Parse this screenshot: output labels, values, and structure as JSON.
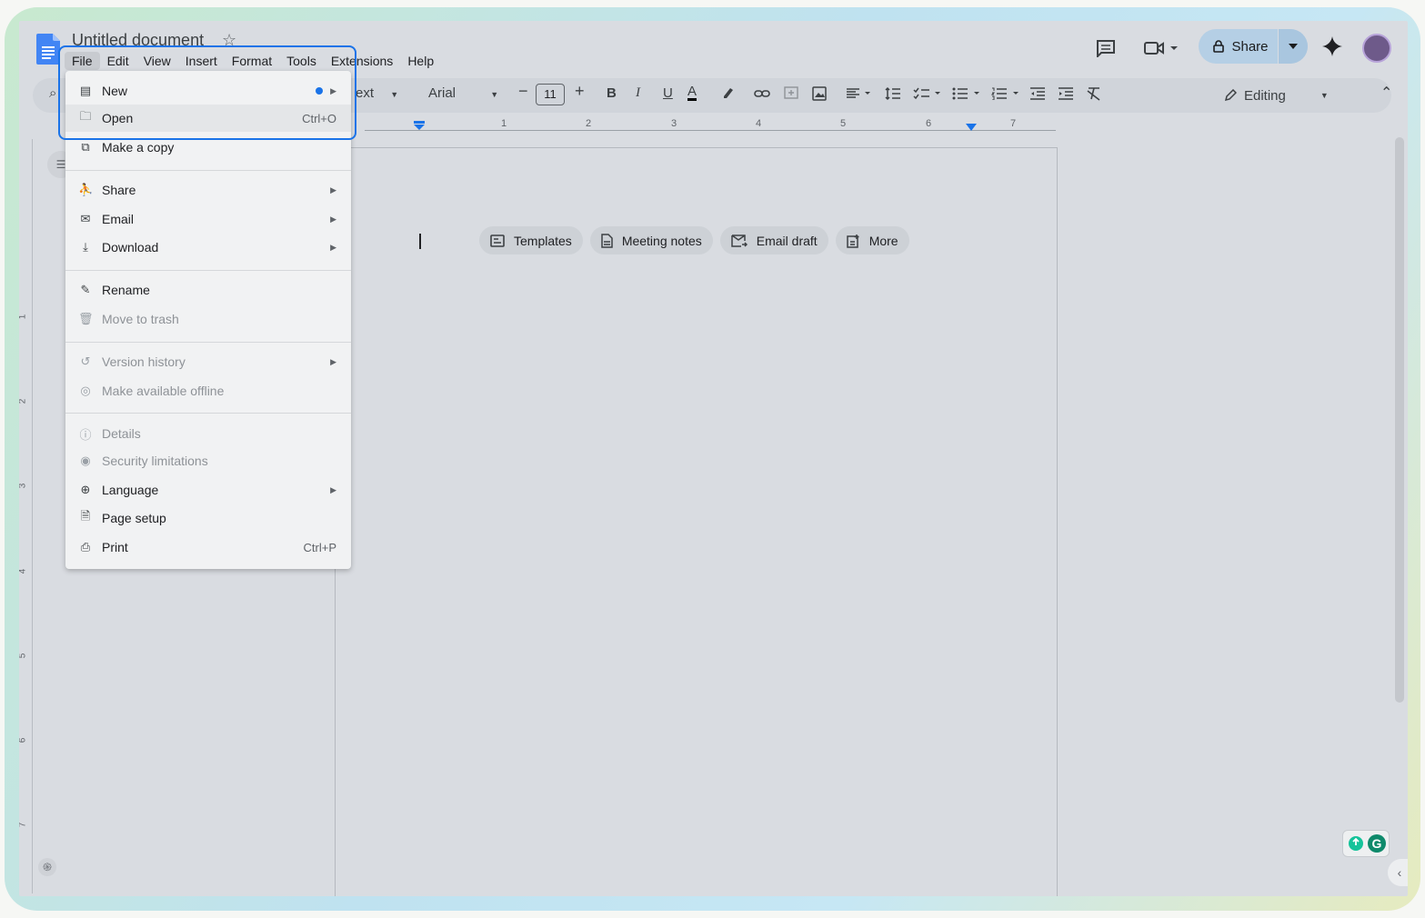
{
  "document": {
    "title": "Untitled document"
  },
  "menubar": {
    "items": [
      "File",
      "Edit",
      "View",
      "Insert",
      "Format",
      "Tools",
      "Extensions",
      "Help"
    ]
  },
  "header": {
    "share_label": "Share"
  },
  "toolbar": {
    "style_label": "ext",
    "font_label": "Arial",
    "font_size": "11",
    "mode_label": "Editing"
  },
  "ruler": {
    "h_numbers": [
      "1",
      "2",
      "3",
      "4",
      "5",
      "6",
      "7"
    ],
    "v_numbers": [
      "1",
      "2",
      "3",
      "4",
      "5",
      "6",
      "7"
    ]
  },
  "chips": [
    {
      "label": "Templates",
      "icon": "template-icon"
    },
    {
      "label": "Meeting notes",
      "icon": "document-icon"
    },
    {
      "label": "Email draft",
      "icon": "email-draft-icon"
    },
    {
      "label": "More",
      "icon": "more-icon"
    }
  ],
  "file_menu": {
    "items": [
      {
        "label": "New",
        "icon": "new-document-icon",
        "shortcut": "",
        "submenu": true,
        "disabled": false
      },
      {
        "label": "Open",
        "icon": "folder-icon",
        "shortcut": "Ctrl+O",
        "submenu": false,
        "disabled": false
      },
      {
        "label": "Make a copy",
        "icon": "copy-icon",
        "shortcut": "",
        "submenu": false,
        "disabled": false
      },
      {
        "label": "Share",
        "icon": "person-add-icon",
        "shortcut": "",
        "submenu": true,
        "disabled": false
      },
      {
        "label": "Email",
        "icon": "email-icon",
        "shortcut": "",
        "submenu": true,
        "disabled": false
      },
      {
        "label": "Download",
        "icon": "download-icon",
        "shortcut": "",
        "submenu": true,
        "disabled": false
      },
      {
        "label": "Rename",
        "icon": "pencil-icon",
        "shortcut": "",
        "submenu": false,
        "disabled": false
      },
      {
        "label": "Move to trash",
        "icon": "trash-icon",
        "shortcut": "",
        "submenu": false,
        "disabled": true
      },
      {
        "label": "Version history",
        "icon": "history-icon",
        "shortcut": "",
        "submenu": true,
        "disabled": true
      },
      {
        "label": "Make available offline",
        "icon": "offline-icon",
        "shortcut": "",
        "submenu": false,
        "disabled": true
      },
      {
        "label": "Details",
        "icon": "info-icon",
        "shortcut": "",
        "submenu": false,
        "disabled": true
      },
      {
        "label": "Security limitations",
        "icon": "security-icon",
        "shortcut": "",
        "submenu": false,
        "disabled": true
      },
      {
        "label": "Language",
        "icon": "globe-icon",
        "shortcut": "",
        "submenu": true,
        "disabled": false
      },
      {
        "label": "Page setup",
        "icon": "page-icon",
        "shortcut": "",
        "submenu": false,
        "disabled": false
      },
      {
        "label": "Print",
        "icon": "printer-icon",
        "shortcut": "Ctrl+P",
        "submenu": false,
        "disabled": false
      }
    ]
  },
  "colors": {
    "accent": "#1a73e8",
    "share_bg": "#b5cfe5"
  }
}
